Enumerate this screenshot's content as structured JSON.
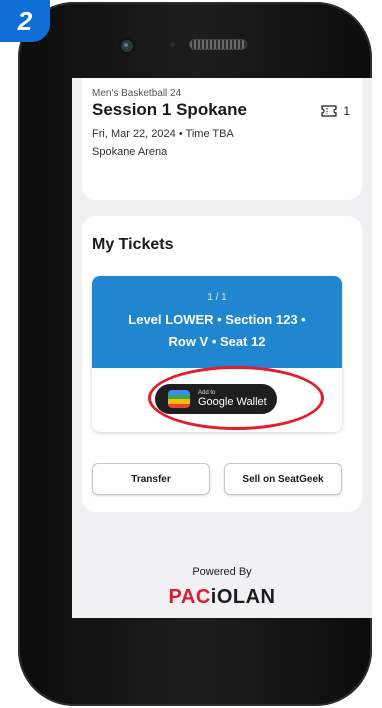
{
  "step": {
    "number": "2"
  },
  "event": {
    "category": "Men's Basketball 24",
    "title": "Session 1 Spokane",
    "ticket_count": "1",
    "date": "Fri, Mar 22, 2024 • Time TBA",
    "venue": "Spokane Arena"
  },
  "tickets_section": {
    "title": "My Tickets",
    "ticket": {
      "index": "1 / 1",
      "seat_line1": "Level LOWER • Section 123 •",
      "seat_line2": "Row V • Seat 12"
    },
    "wallet_button": {
      "small": "Add to",
      "label": "Google Wallet"
    },
    "transfer_label": "Transfer",
    "sell_label": "Sell on SeatGeek"
  },
  "footer": {
    "powered_by": "Powered By",
    "brand_part1": "PAC",
    "brand_part2": "iOLAN"
  },
  "colors": {
    "accent_blue": "#1f86cf",
    "highlight_red": "#e41c2b",
    "brand_red": "#d81e2c"
  },
  "icons": {
    "ticket": "ticket-icon",
    "wallet": "google-wallet-icon"
  }
}
